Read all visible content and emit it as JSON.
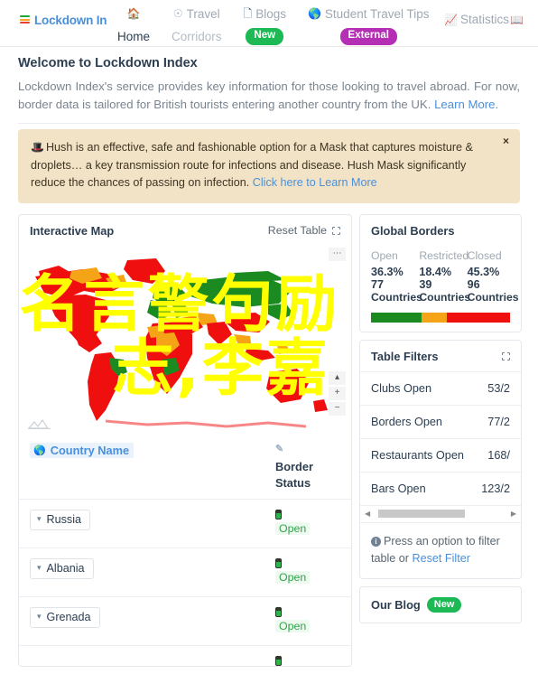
{
  "brand": {
    "label": "Lockdown Inde"
  },
  "nav": {
    "items": [
      {
        "icon": "home-icon",
        "icon_glyph": "⌂",
        "label": "",
        "sub": "Home",
        "pill": null
      },
      {
        "icon": "compass-icon",
        "icon_glyph": "⊙",
        "label": "Travel",
        "sub": "Corridors",
        "pill": null
      },
      {
        "icon": "file-icon",
        "icon_glyph": "὜b",
        "label": "Blogs",
        "sub": null,
        "pill": "New"
      },
      {
        "icon": "globe-icon",
        "icon_glyph": "ἱ0",
        "label": "Student Travel Tips",
        "sub": null,
        "pill": "External"
      }
    ],
    "right": {
      "label": "Statistics",
      "icon": "chart-icon",
      "book_icon": "book-icon"
    }
  },
  "welcome": {
    "title": "Welcome to Lockdown Index",
    "body_1": "Lockdown Index's service provides key information for those looking to travel abroad. For now, border data is tailored for British tourists entering another country from the UK. ",
    "link": "Learn More",
    "body_2": "."
  },
  "alert": {
    "icon": "hat-icon",
    "text": "Hush is an effective, safe and fashionable option for a Mask that captures moisture & droplets… a key transmission route for infections and disease. Hush Mask significantly reduce the chances of passing on infection. ",
    "link": "Click here to Learn More",
    "close_label": "×"
  },
  "map_card": {
    "title": "Interactive Map",
    "reset_label": "Reset Table",
    "controls": [
      {
        "name": "map-menu-button",
        "glyph": "⋯"
      },
      {
        "name": "map-pan-button",
        "glyph": "▴"
      },
      {
        "name": "map-zoom-in-button",
        "glyph": "+"
      },
      {
        "name": "map-zoom-out-button",
        "glyph": "−"
      }
    ],
    "watermark_line_1": "名言警句励",
    "watermark_line_2": "志,李嘉",
    "colors": {
      "open": "#1a8a21",
      "restricted": "#f5a417",
      "closed": "#ef0f0f"
    }
  },
  "table": {
    "col_country": "Country Name",
    "col_status": "Border Status",
    "rows": [
      {
        "country": "Russia",
        "status": "Open"
      },
      {
        "country": "Albania",
        "status": "Open"
      },
      {
        "country": "Grenada",
        "status": "Open"
      }
    ]
  },
  "global_borders": {
    "title": "Global Borders",
    "columns": [
      {
        "name": "Open",
        "pct": "36.3%",
        "count": "77",
        "unit": "Countries"
      },
      {
        "name": "Restricted",
        "pct": "18.4%",
        "count": "39",
        "unit": "Countries"
      },
      {
        "name": "Closed",
        "pct": "45.3%",
        "count": "96",
        "unit": "Countries"
      }
    ],
    "bar": [
      36.3,
      18.4,
      45.3
    ]
  },
  "filters": {
    "title": "Table Filters",
    "rows": [
      {
        "label": "Clubs Open",
        "value": "53/2"
      },
      {
        "label": "Borders Open",
        "value": "77/2"
      },
      {
        "label": "Restaurants Open",
        "value": "168/"
      },
      {
        "label": "Bars Open",
        "value": "123/2"
      }
    ],
    "note_1": "Press an option to filter table or ",
    "note_link": "Reset Filter"
  },
  "blog": {
    "title": "Our Blog",
    "pill": "New"
  }
}
